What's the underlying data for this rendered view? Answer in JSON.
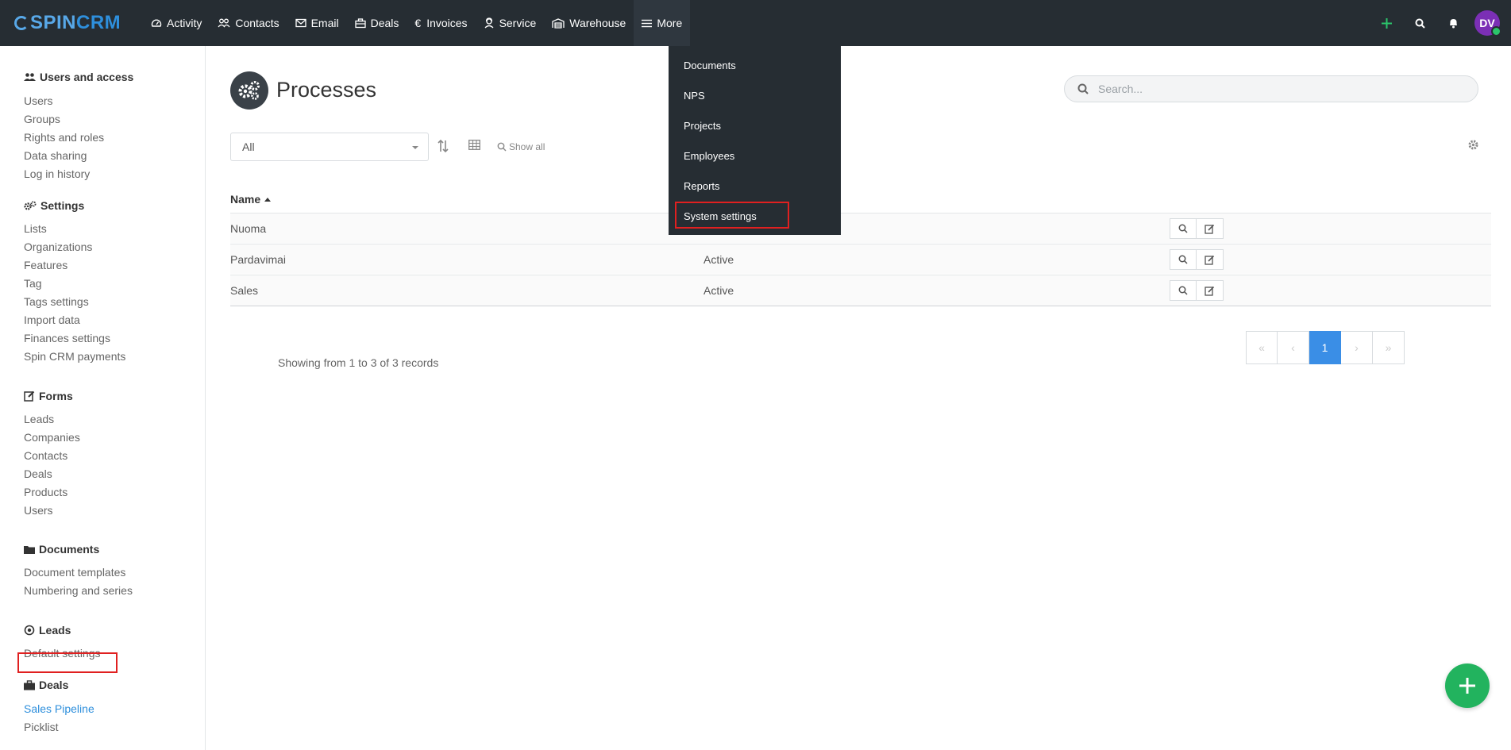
{
  "app": {
    "logo_spin": "SPIN",
    "logo_crm": "CRM"
  },
  "nav": [
    {
      "label": "Activity",
      "icon": "gauge-icon"
    },
    {
      "label": "Contacts",
      "icon": "users-icon"
    },
    {
      "label": "Email",
      "icon": "envelope-icon"
    },
    {
      "label": "Deals",
      "icon": "briefcase-icon"
    },
    {
      "label": "Invoices",
      "icon": "euro-icon"
    },
    {
      "label": "Service",
      "icon": "support-icon"
    },
    {
      "label": "Warehouse",
      "icon": "warehouse-icon"
    },
    {
      "label": "More",
      "icon": "menu-icon"
    }
  ],
  "user": {
    "initials": "DV",
    "status_color": "#2bc46b"
  },
  "more_menu": {
    "items": [
      "Documents",
      "NPS",
      "Projects",
      "Employees",
      "Reports",
      "System settings"
    ],
    "highlighted": "System settings"
  },
  "sidebar": {
    "groups": [
      {
        "title": "Users and access",
        "icon": "users-icon",
        "links": [
          "Users",
          "Groups",
          "Rights and roles",
          "Data sharing",
          "Log in history"
        ]
      },
      {
        "title": "Settings",
        "icon": "cogs-icon",
        "links": [
          "Lists",
          "Organizations",
          "Features",
          "Tag",
          "Tags settings",
          "Import data",
          "Finances settings",
          "Spin CRM payments"
        ]
      },
      {
        "title": "Forms",
        "icon": "edit-icon",
        "links": [
          "Leads",
          "Companies",
          "Contacts",
          "Deals",
          "Products",
          "Users"
        ]
      },
      {
        "title": "Documents",
        "icon": "folder-icon",
        "links": [
          "Document templates",
          "Numbering and series"
        ]
      },
      {
        "title": "Leads",
        "icon": "target-icon",
        "links": [
          "Default settings"
        ]
      },
      {
        "title": "Deals",
        "icon": "briefcase-icon",
        "links": [
          "Sales Pipeline",
          "Picklist"
        ]
      }
    ],
    "selected": "Sales Pipeline"
  },
  "page": {
    "title": "Processes",
    "search_placeholder": "Search...",
    "filter_value": "All",
    "show_all": "Show all",
    "column_name": "Name",
    "rows": [
      {
        "name": "Nuoma",
        "status": ""
      },
      {
        "name": "Pardavimai",
        "status": "Active"
      },
      {
        "name": "Sales",
        "status": "Active"
      }
    ],
    "records_text": "Showing from 1 to 3 of 3 records",
    "current_page": "1"
  },
  "colors": {
    "accent": "#2e8fdc",
    "fab": "#22b35e",
    "topbar": "#262d33",
    "highlight": "#e02020"
  }
}
